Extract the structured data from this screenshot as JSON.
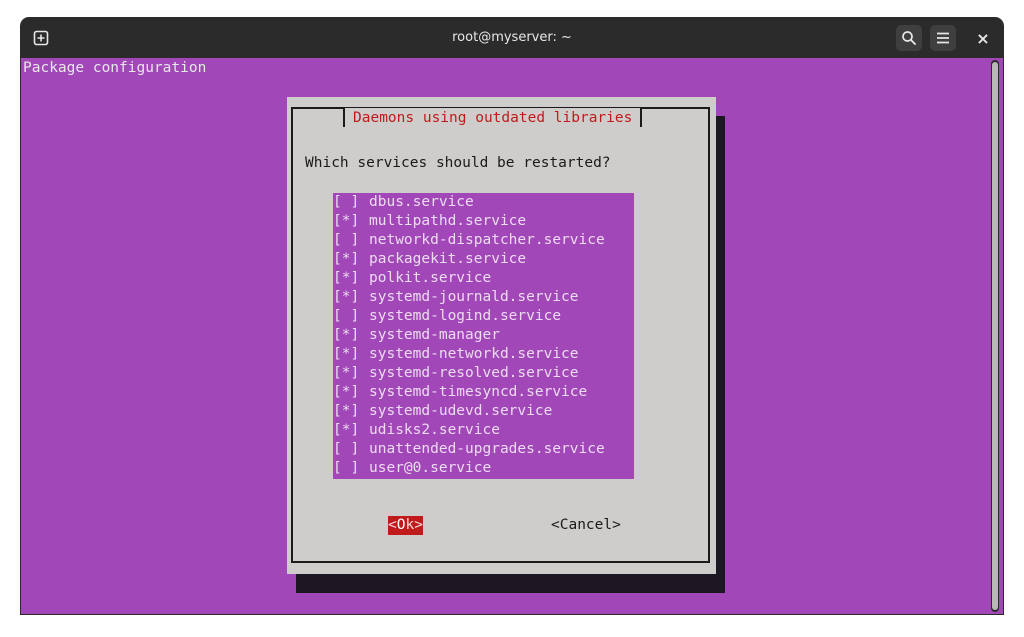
{
  "window": {
    "title": "root@myserver: ~",
    "icons": {
      "new_tab": "new-tab-icon",
      "search": "search-icon",
      "menu": "hamburger-menu-icon",
      "close": "close-icon"
    },
    "close_glyph": "×"
  },
  "terminal": {
    "header": "Package configuration"
  },
  "dialog": {
    "title": "Daemons using outdated libraries",
    "question": "Which services should be restarted?",
    "items": [
      {
        "mark": "[ ]",
        "label": "dbus.service"
      },
      {
        "mark": "[*]",
        "label": "multipathd.service"
      },
      {
        "mark": "[ ]",
        "label": "networkd-dispatcher.service"
      },
      {
        "mark": "[*]",
        "label": "packagekit.service"
      },
      {
        "mark": "[*]",
        "label": "polkit.service"
      },
      {
        "mark": "[*]",
        "label": "systemd-journald.service"
      },
      {
        "mark": "[ ]",
        "label": "systemd-logind.service"
      },
      {
        "mark": "[*]",
        "label": "systemd-manager"
      },
      {
        "mark": "[*]",
        "label": "systemd-networkd.service"
      },
      {
        "mark": "[*]",
        "label": "systemd-resolved.service"
      },
      {
        "mark": "[*]",
        "label": "systemd-timesyncd.service"
      },
      {
        "mark": "[*]",
        "label": "systemd-udevd.service"
      },
      {
        "mark": "[*]",
        "label": "udisks2.service"
      },
      {
        "mark": "[ ]",
        "label": "unattended-upgrades.service"
      },
      {
        "mark": "[ ]",
        "label": "user@0.service"
      }
    ],
    "ok_open": "<",
    "ok_hotkey": "O",
    "ok_rest": "k>",
    "cancel_label": "<Cancel>"
  },
  "colors": {
    "terminal_bg": "#a247b8",
    "titlebar_bg": "#2b2b2b",
    "dialog_bg": "#cfcdcb",
    "dialog_title": "#c11a1a",
    "ok_button_bg": "#c11a1a"
  }
}
